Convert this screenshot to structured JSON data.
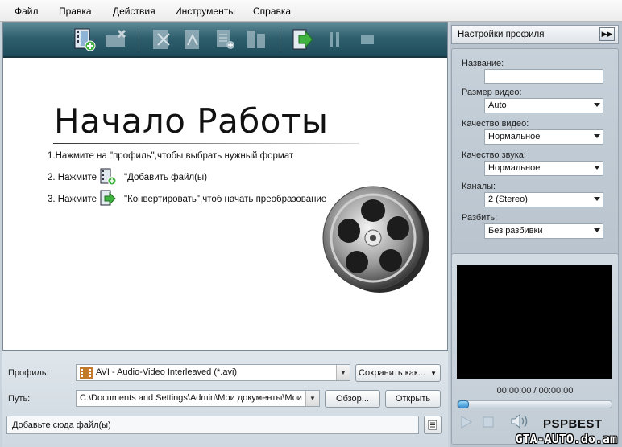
{
  "menu": [
    "Файл",
    "Правка",
    "Действия",
    "Инструменты",
    "Справка"
  ],
  "toolbar": {
    "icons": [
      "add-video-icon",
      "remove-icon",
      "cut-icon",
      "split-icon",
      "add-file-icon",
      "merge-icon",
      "convert-icon",
      "pause-icon",
      "stop-icon"
    ]
  },
  "welcome": {
    "title": "Начало Работы",
    "step1": "1.Нажмите на \"профиль\",чтобы выбрать нужный формат",
    "step2_prefix": "2. Нажмите",
    "step2_suffix": "\"Добавить файл(ы)",
    "step3_prefix": "3. Нажмите",
    "step3_suffix": "\"Конвертировать\",чтоб начать преобразование"
  },
  "bottom": {
    "profile_label": "Профиль:",
    "profile_value": "AVI - Audio-Video Interleaved (*.avi)",
    "save_as_label": "Сохранить как...",
    "path_label": "Путь:",
    "path_value": "C:\\Documents and Settings\\Admin\\Мои документы\\Мои в",
    "browse_label": "Обзор...",
    "open_label": "Открыть",
    "status": "Добавьте сюда файл(ы)"
  },
  "profile_settings": {
    "header": "Настройки профиля",
    "name_label": "Название:",
    "name_value": "",
    "video_size_label": "Размер видео:",
    "video_size_value": "Auto",
    "video_quality_label": "Качество видео:",
    "video_quality_value": "Нормальное",
    "audio_quality_label": "Качество звука:",
    "audio_quality_value": "Нормальное",
    "channels_label": "Каналы:",
    "channels_value": "2 (Stereo)",
    "split_label": "Разбить:",
    "split_value": "Без разбивки"
  },
  "player": {
    "time": "00:00:00 / 00:00:00",
    "progress": 0,
    "brand": "PSPBEST"
  },
  "watermark": "GTA-AUTO.do.am",
  "colors": {
    "toolbar": "#2f5e6c",
    "accent": "#3a8fd0",
    "panel": "#b9c4ce"
  }
}
